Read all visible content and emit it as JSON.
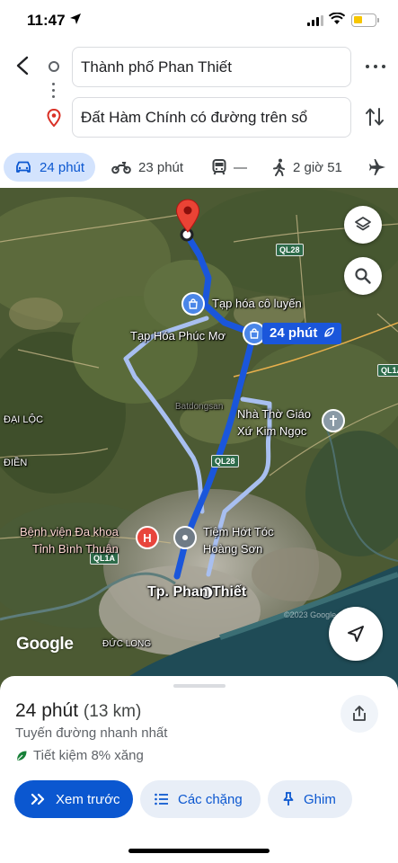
{
  "status_bar": {
    "time": "11:47"
  },
  "route": {
    "origin": "Thành phố Phan Thiết",
    "destination": "Đất Hàm Chính có đường trên sổ"
  },
  "modes": [
    {
      "name": "car",
      "label": "24 phút",
      "active": true
    },
    {
      "name": "motorbike",
      "label": "23 phút"
    },
    {
      "name": "transit",
      "label": "—"
    },
    {
      "name": "walk",
      "label": "2 giờ 51"
    },
    {
      "name": "flight",
      "label": ""
    }
  ],
  "map": {
    "route_badge": "24 phút",
    "road_labels": [
      "QL28",
      "QL28",
      "QL1A",
      "QL1A"
    ],
    "places": {
      "tap_hoa_co_luyen": "Tạp hóa cô luyến",
      "tap_hoa_phuc_mo": "Tạp Hóa Phúc Mơ",
      "nha_tho": "Nhà Thờ Giáo\nXứ Kim Ngọc",
      "benh_vien": "Bệnh viện Đa khoa\nTỉnh Bình Thuận",
      "tiem_hot_toc": "Tiệm Hớt Tóc\nHoàng Sơn",
      "tp_phan_thiet": "Tp. Phan Thiết",
      "dai_loc": "ĐẠI LỘC",
      "dien": "ĐIỀN",
      "duc_long": "ĐỨC LONG",
      "watermark": "Batdongsan"
    },
    "google_logo": "Google",
    "copyright": "©2023 Google"
  },
  "sheet": {
    "duration": "24 phút",
    "distance": "(13 km)",
    "description": "Tuyến đường nhanh nhất",
    "fuel_saving": "Tiết kiệm 8% xăng",
    "actions": {
      "preview": "Xem trước",
      "steps": "Các chặng",
      "pin": "Ghim"
    }
  },
  "colors": {
    "accent": "#0b57d0",
    "route": "#1a56db",
    "route_alt": "#a8bff0",
    "chip_bg": "#d3e3fd"
  }
}
